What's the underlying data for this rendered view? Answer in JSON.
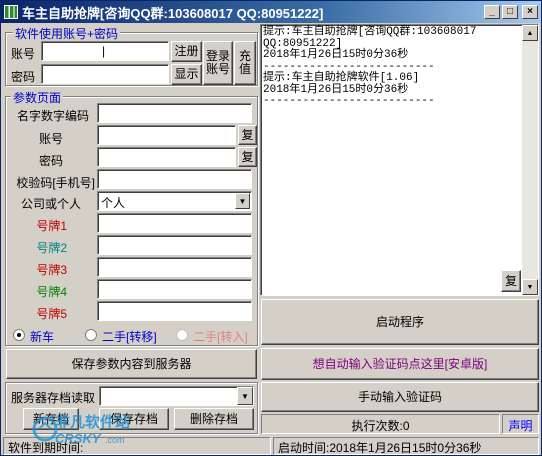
{
  "window": {
    "title": "车主自助抢牌[咨询QQ群:103608017  QQ:80951222]",
    "min_label": "_",
    "max_label": "□",
    "close_label": "×"
  },
  "login": {
    "group_title": "软件使用账号+密码",
    "account_label": "账号",
    "account_value": "|",
    "password_label": "密码",
    "password_value": "",
    "register_button": "注册",
    "show_button": "显示",
    "login_button": "登录账号",
    "recharge_button": "充值"
  },
  "params": {
    "group_title": "参数页面",
    "name_code_label": "名字数字编码",
    "name_code_value": "",
    "account_label": "账号",
    "account_value": "",
    "password_label": "密码",
    "password_value": "",
    "copy_button": "复",
    "verify_label": "校验码[手机号]",
    "verify_value": "",
    "company_label": "公司或个人",
    "company_value": "个人",
    "plates": [
      {
        "label": "号牌1",
        "value": "",
        "color": "#c00000"
      },
      {
        "label": "号牌2",
        "value": "",
        "color": "#008080"
      },
      {
        "label": "号牌3",
        "value": "",
        "color": "#c00000"
      },
      {
        "label": "号牌4",
        "value": "",
        "color": "#008000"
      },
      {
        "label": "号牌5",
        "value": "",
        "color": "#c00000"
      }
    ],
    "radio_new": "新车",
    "radio_used_move": "二手[转移]",
    "radio_used_transfer": "二手[转入]",
    "radio_selected": "新车"
  },
  "server": {
    "save_button": "保存参数内容到服务器",
    "archive_label": "服务器存档读取",
    "archive_value": "",
    "new_button": "新存档",
    "save_archive_button": "保存存档",
    "delete_button": "删除存档"
  },
  "log": {
    "lines": "提示:车主自助抢牌[咨询QQ群:103608017\nQQ:80951222]\n2018年1月26日15时0分36秒\n--------------------------\n提示:车主自助抢牌软件[1.06]\n2018年1月26日15时0分36秒\n--------------------------",
    "copy_button": "复"
  },
  "actions": {
    "start_button": "启动程序",
    "auto_captcha_button": "想自动输入验证码点这里[安卓版]",
    "manual_captcha_button": "手动输入验证码",
    "exec_count": "执行次数:0",
    "declare_link": "声明"
  },
  "statusbar": {
    "left": "软件到期时间:",
    "right": "启动时间:2018年1月26日15时0分36秒"
  },
  "watermark": {
    "cn": "非凡软件站",
    "en": "CRSKY",
    "suffix": ".com"
  },
  "colors": {
    "accent_blue": "#0000cc",
    "link_blue": "#0000ff",
    "purple": "#800080",
    "radio_disabled": "#e08080"
  }
}
